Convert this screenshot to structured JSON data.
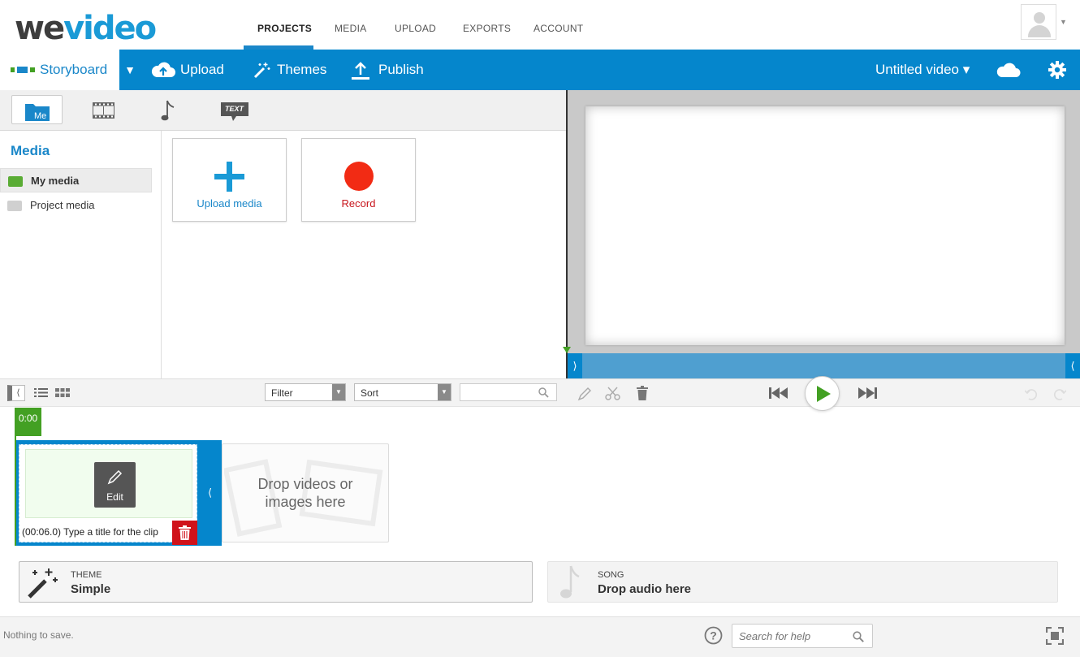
{
  "app": {
    "logo_text_a": "we",
    "logo_text_b": "video",
    "accent_color": "#0586cc",
    "green_color": "#43a023",
    "red_color": "#d0121a"
  },
  "topnav": {
    "items": [
      {
        "label": "PROJECTS",
        "active": true
      },
      {
        "label": "MEDIA",
        "active": false
      },
      {
        "label": "UPLOAD",
        "active": false
      },
      {
        "label": "EXPORTS",
        "active": false
      },
      {
        "label": "ACCOUNT",
        "active": false
      }
    ],
    "avatar_icon": "user-avatar-icon"
  },
  "toolbar": {
    "mode_label": "Storyboard",
    "mode_caret": "▼",
    "upload_label": "Upload",
    "themes_label": "Themes",
    "publish_label": "Publish",
    "project_title": "Untitled video ▾"
  },
  "media_tabs": {
    "me_label": "Me",
    "text_label": "TEXT"
  },
  "media_panel": {
    "heading": "Media",
    "sidebar": [
      {
        "label": "My media",
        "selected": true
      },
      {
        "label": "Project media",
        "selected": false
      }
    ],
    "cards": [
      {
        "label": "Upload media",
        "icon": "plus-icon"
      },
      {
        "label": "Record",
        "icon": "record-icon"
      }
    ]
  },
  "preview": {
    "left_handle": "⟩",
    "right_handle": "⟨"
  },
  "controls": {
    "collapse": "⟨",
    "filter_label": "Filter",
    "sort_label": "Sort",
    "search_value": ""
  },
  "timeline": {
    "time": "0:00",
    "clip_edit_label": "Edit",
    "clip_title": "(00:06.0) Type a title for the clip",
    "clip_handle": "⟨",
    "drop_text_line1": "Drop videos or",
    "drop_text_line2": "images here"
  },
  "theme": {
    "caption": "THEME",
    "value": "Simple"
  },
  "song": {
    "caption": "SONG",
    "value": "Drop audio here"
  },
  "status": {
    "text": "Nothing to save.",
    "help_placeholder": "Search for help"
  }
}
